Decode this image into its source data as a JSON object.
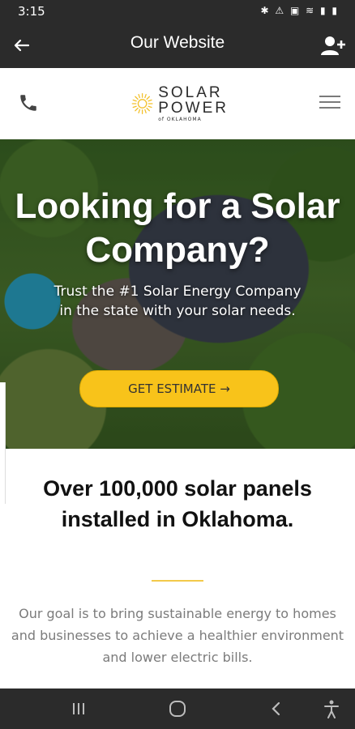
{
  "status": {
    "time": "3:15",
    "icons": "✱ ⚠ ▣ ≋ ▮ ▮"
  },
  "appbar": {
    "title": "Our Website",
    "back_icon": "arrow-left-icon",
    "add_user_icon": "person-add-icon"
  },
  "site": {
    "logo": {
      "line1": "SOLAR",
      "line2": "POWER",
      "line3": "of OKLAHOMA",
      "accent": "#f3c12c"
    },
    "phone_icon": "phone-icon",
    "menu_icon": "hamburger-menu-icon"
  },
  "hero": {
    "title": "Looking for a Solar Company?",
    "subtitle": "Trust the #1 Solar Energy Company in the state with your solar needs.",
    "cta_label": "GET ESTIMATE →",
    "cta_color": "#f8c31a"
  },
  "stats": {
    "title": "Over 100,000 solar panels installed in Oklahoma.",
    "body": "Our goal is to bring sustainable energy to homes and businesses to achieve a healthier environment and lower electric bills."
  },
  "navbar": {
    "recents_icon": "recents-icon",
    "home_icon": "home-icon",
    "back_icon": "back-chevron-icon",
    "accessibility_icon": "accessibility-icon"
  }
}
